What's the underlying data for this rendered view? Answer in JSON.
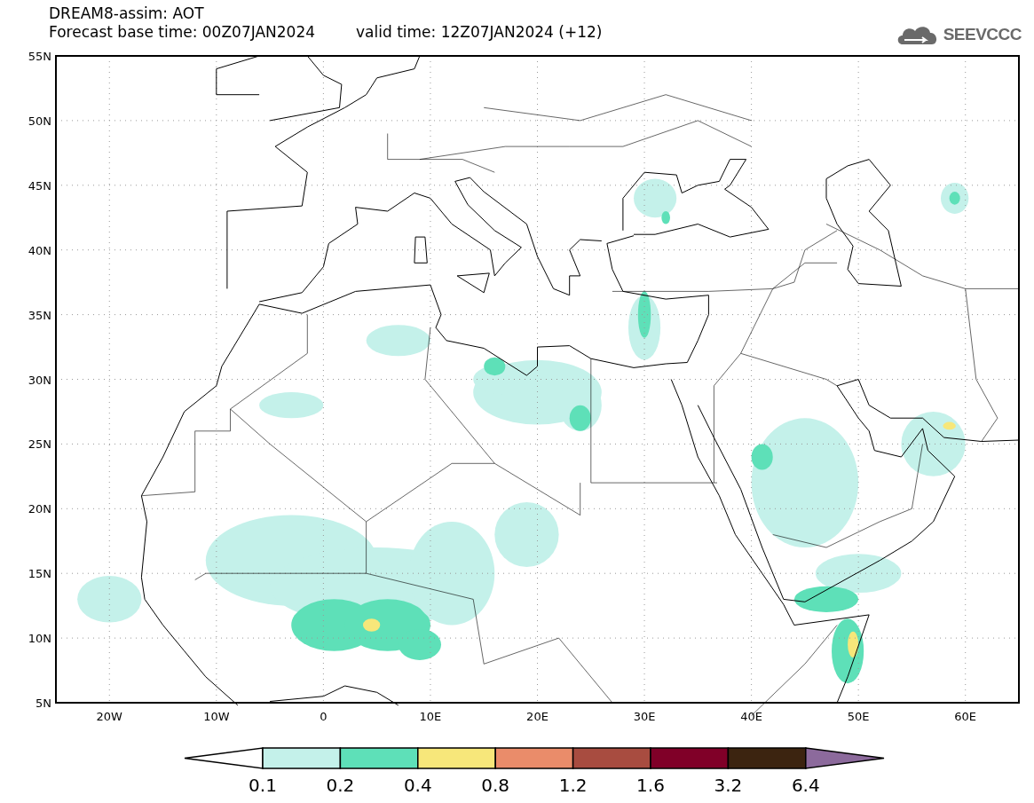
{
  "title": {
    "line_1": "DREAM8-assim: AOT",
    "base_time": "Forecast base time: 00Z07JAN2024",
    "valid_time": "valid time: 12Z07JAN2024 (+12)"
  },
  "logo": {
    "text": "SEEVCCC"
  },
  "map": {
    "x_ticks": [
      "20W",
      "10W",
      "0",
      "10E",
      "20E",
      "30E",
      "40E",
      "50E",
      "60E"
    ],
    "y_ticks": [
      "55N",
      "50N",
      "45N",
      "40N",
      "35N",
      "30N",
      "25N",
      "20N",
      "15N",
      "10N",
      "5N"
    ]
  },
  "colorbar": {
    "bins": [
      {
        "kind": "low_triangle",
        "color": "#ffffff"
      },
      {
        "kind": "box",
        "color": "#c4f1ea"
      },
      {
        "kind": "box",
        "color": "#5ee0b8"
      },
      {
        "kind": "box",
        "color": "#f7e77a"
      },
      {
        "kind": "box",
        "color": "#ea8c6a"
      },
      {
        "kind": "box",
        "color": "#a84c40"
      },
      {
        "kind": "box",
        "color": "#800028"
      },
      {
        "kind": "box",
        "color": "#3c2410"
      },
      {
        "kind": "high_triangle",
        "color": "#8c6a9c"
      }
    ],
    "labels": [
      "0.1",
      "0.2",
      "0.4",
      "0.8",
      "1.2",
      "1.6",
      "3.2",
      "6.4"
    ]
  }
}
